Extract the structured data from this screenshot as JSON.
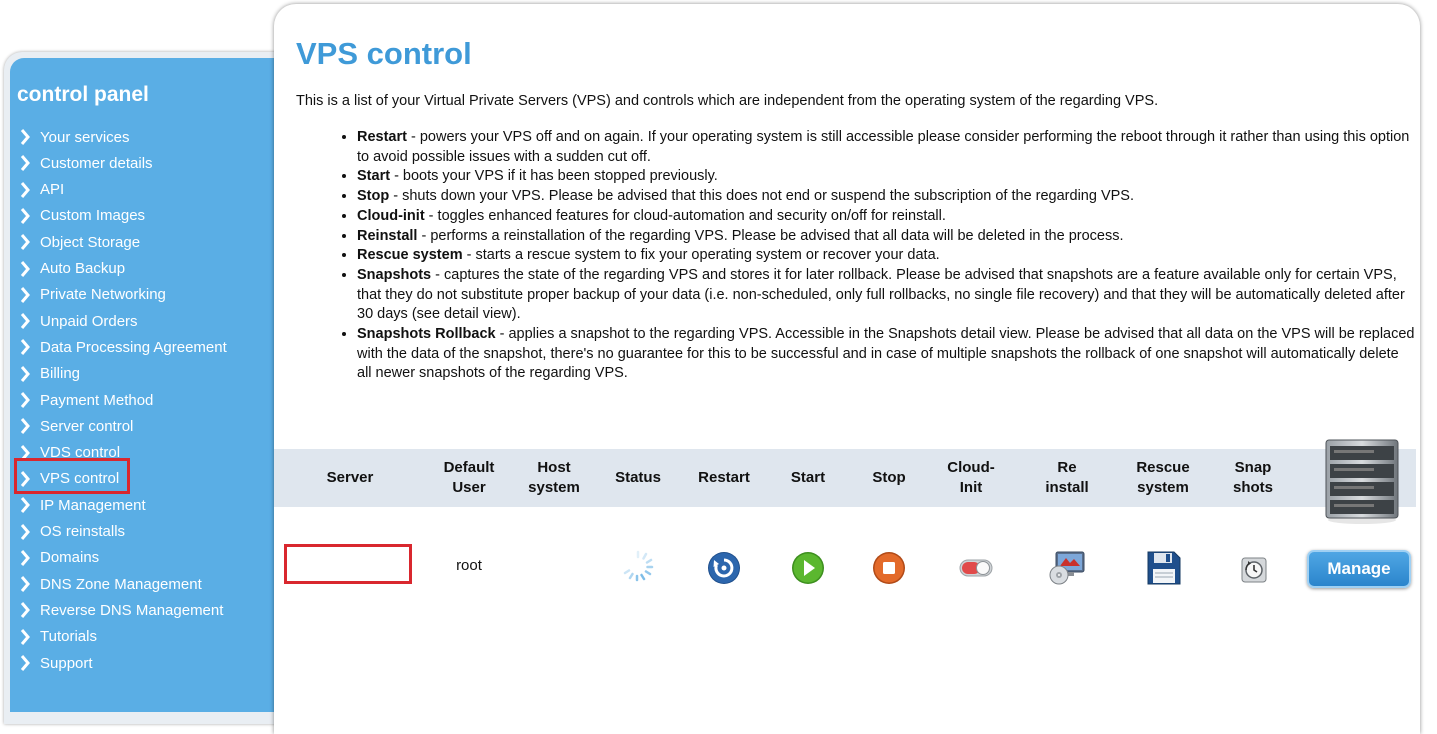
{
  "sidebar": {
    "title": "control panel",
    "items": [
      {
        "label": "Your services"
      },
      {
        "label": "Customer details"
      },
      {
        "label": "API"
      },
      {
        "label": "Custom Images"
      },
      {
        "label": "Object Storage"
      },
      {
        "label": "Auto Backup"
      },
      {
        "label": "Private Networking"
      },
      {
        "label": "Unpaid Orders"
      },
      {
        "label": "Data Processing Agreement"
      },
      {
        "label": "Billing"
      },
      {
        "label": "Payment Method"
      },
      {
        "label": "Server control"
      },
      {
        "label": "VDS control"
      },
      {
        "label": "VPS control"
      },
      {
        "label": "IP Management"
      },
      {
        "label": "OS reinstalls"
      },
      {
        "label": "Domains"
      },
      {
        "label": "DNS Zone Management"
      },
      {
        "label": "Reverse DNS Management"
      },
      {
        "label": "Tutorials"
      },
      {
        "label": "Support"
      }
    ],
    "highlighted_item": "VPS control"
  },
  "main": {
    "title": "VPS control",
    "intro": "This is a list of your Virtual Private Servers (VPS) and controls which are independent from the operating system of the regarding VPS.",
    "bullets": [
      {
        "term": "Restart",
        "text": " - powers your VPS off and on again. If your operating system is still accessible please consider performing the reboot through it rather than using this option to avoid possible issues with a sudden cut off."
      },
      {
        "term": "Start",
        "text": " - boots your VPS if it has been stopped previously."
      },
      {
        "term": "Stop",
        "text": " - shuts down your VPS. Please be advised that this does not end or suspend the subscription of the regarding VPS."
      },
      {
        "term": "Cloud-init",
        "text": " - toggles enhanced features for cloud-automation and security on/off for reinstall."
      },
      {
        "term": "Reinstall",
        "text": " - performs a reinstallation of the regarding VPS. Please be advised that all data will be deleted in the process."
      },
      {
        "term": "Rescue system",
        "text": " - starts a rescue system to fix your operating system or recover your data."
      },
      {
        "term": "Snapshots",
        "text": " - captures the state of the regarding VPS and stores it for later rollback. Please be advised that snapshots are a feature available only for certain VPS, that they do not substitute proper backup of your data (i.e. non-scheduled, only full rollbacks, no single file recovery) and that they will be automatically deleted after 30 days (see detail view)."
      },
      {
        "term": "Snapshots Rollback",
        "text": " - applies a snapshot to the regarding VPS. Accessible in the Snapshots detail view. Please be advised that all data on the VPS will be replaced with the data of the snapshot, there's no guarantee for this to be successful and in case of multiple snapshots the rollback of one snapshot will automatically delete all newer snapshots of the regarding VPS."
      }
    ],
    "table": {
      "headers": [
        {
          "l1": "Server",
          "l2": ""
        },
        {
          "l1": "Default",
          "l2": "User"
        },
        {
          "l1": "Host",
          "l2": "system"
        },
        {
          "l1": "Status",
          "l2": ""
        },
        {
          "l1": "Restart",
          "l2": ""
        },
        {
          "l1": "Start",
          "l2": ""
        },
        {
          "l1": "Stop",
          "l2": ""
        },
        {
          "l1": "Cloud-",
          "l2": "Init"
        },
        {
          "l1": "Re",
          "l2": "install"
        },
        {
          "l1": "Rescue",
          "l2": "system"
        },
        {
          "l1": "Snap",
          "l2": "shots"
        }
      ],
      "row": {
        "server": "",
        "default_user": "root",
        "host_system": "",
        "manage_label": "Manage"
      }
    }
  },
  "colors": {
    "sidebar_bg": "#5aaee5",
    "title_blue": "#3f9ad8",
    "highlight_red": "#d9272e",
    "table_header_bg": "#dfe6ee"
  },
  "icons": {
    "status": "loading-spinner-icon",
    "restart": "restart-icon",
    "start": "play-icon",
    "stop": "stop-icon",
    "cloud_init": "toggle-icon",
    "reinstall": "reinstall-icon",
    "rescue": "floppy-disk-icon",
    "snapshots": "snapshot-icon",
    "header_image": "server-rack-icon"
  }
}
